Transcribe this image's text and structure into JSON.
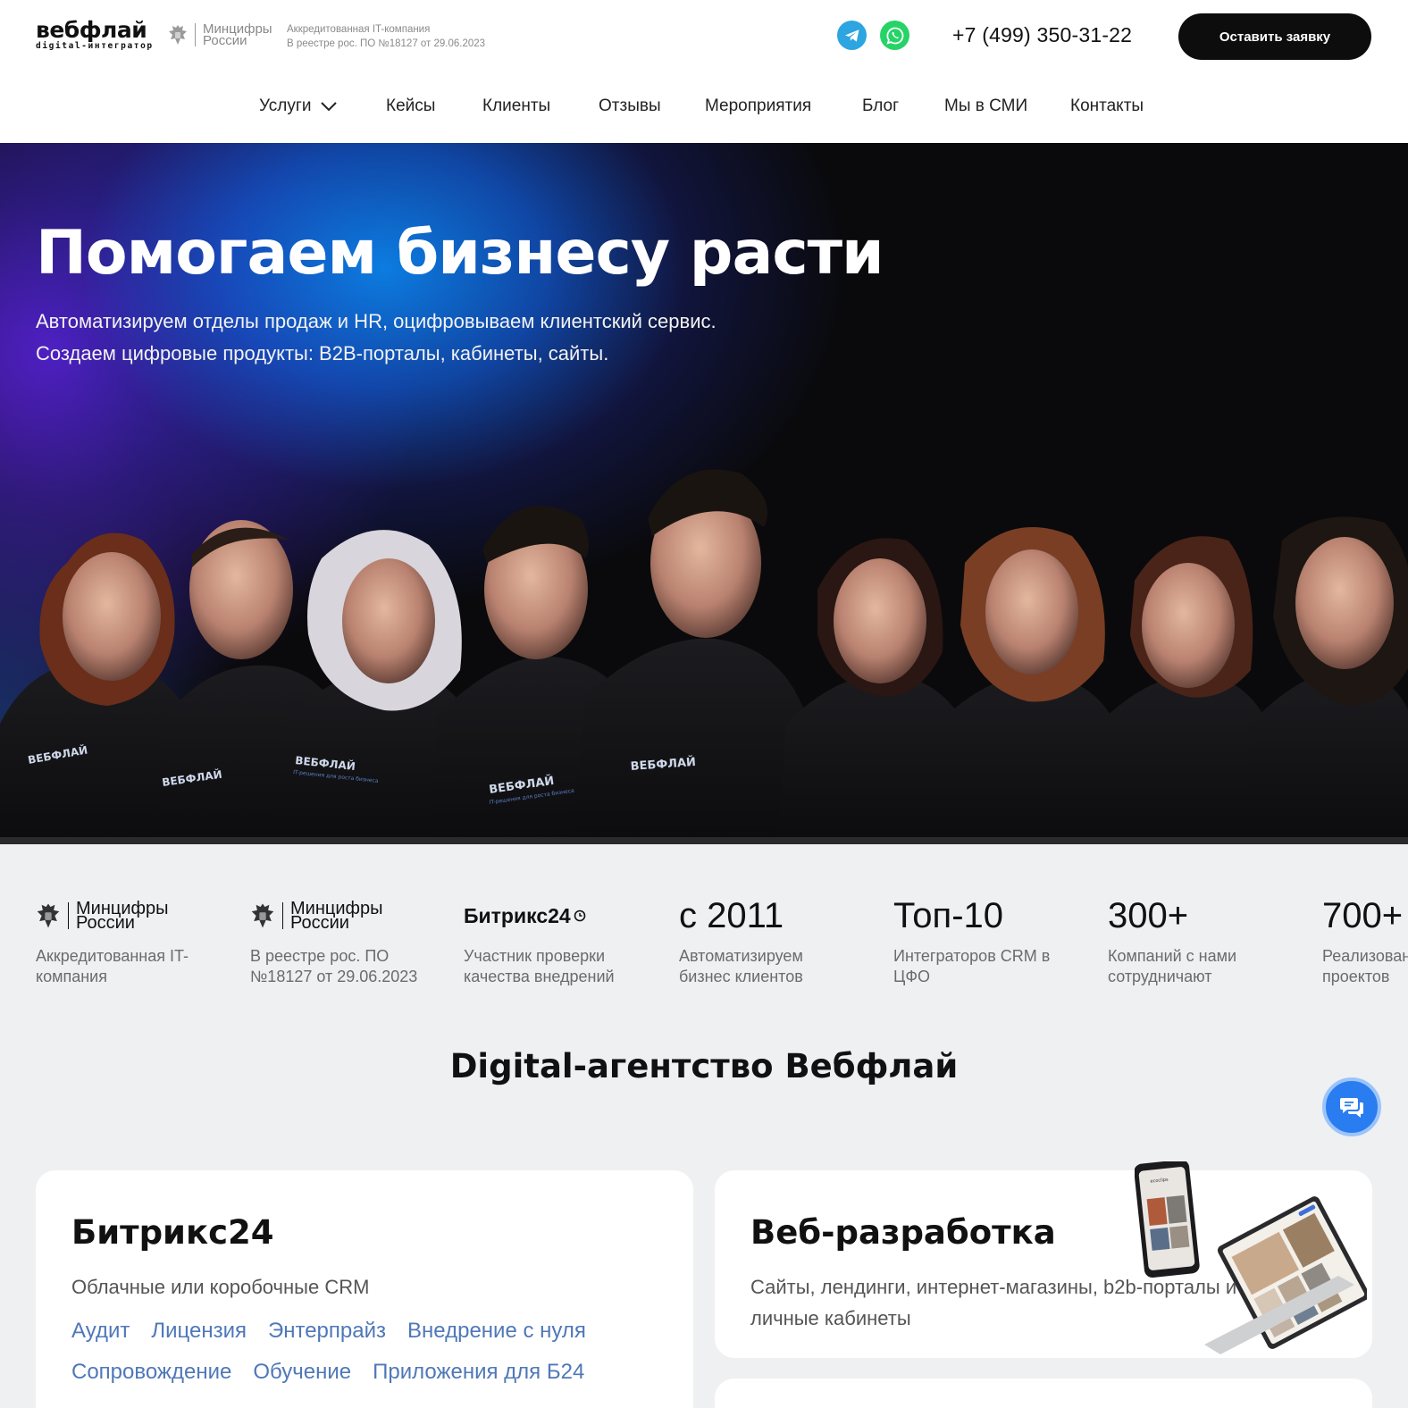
{
  "header": {
    "logo_main": "вебфлай",
    "logo_sub": "digital-интегратор",
    "mincifry_line1": "Минцифры",
    "mincifry_line2": "России",
    "accred_line1": "Аккредитованная IT-компания",
    "accred_line2": "В реестре рос. ПО №18127 от 29.06.2023",
    "phone": "+7 (499) 350-31-22",
    "cta": "Оставить заявку",
    "icons": [
      "telegram-icon",
      "whatsapp-icon",
      "chevron-down-icon"
    ]
  },
  "nav": {
    "items": [
      "Услуги",
      "Кейсы",
      "Клиенты",
      "Отзывы",
      "Мероприятия",
      "Блог",
      "Мы в СМИ",
      "Контакты"
    ]
  },
  "hero": {
    "title": "Помогаем бизнесу расти",
    "subtitle": "Автоматизируем отделы продаж и HR, оцифровываем клиентский сервис. Создаем цифровые продукты: B2B-порталы, кабинеты, сайты.",
    "hoodie_print": "ВЕБФЛАЙ",
    "hoodie_tagline": "IT-решения для роста бизнеса"
  },
  "stats": [
    {
      "line1": "Минцифры",
      "line2": "России",
      "desc": "Аккредитованная IT-компания"
    },
    {
      "line1": "Минцифры",
      "line2": "России",
      "desc": "В реестре рос. ПО №18127 от 29.06.2023"
    },
    {
      "logo": "Битрикс24",
      "desc": "Участник проверки качества внедрений"
    },
    {
      "big": "с 2011",
      "desc": "Автоматизируем бизнес клиентов"
    },
    {
      "big": "Топ-10",
      "desc": "Интеграторов CRM в ЦФО"
    },
    {
      "big": "300+",
      "desc": "Компаний с нами сотрудничают"
    },
    {
      "big": "700+",
      "desc": "Реализованных проектов"
    }
  ],
  "section": {
    "title": "Digital-агентство Вебфлай"
  },
  "cards": {
    "bitrix": {
      "title": "Битрикс24",
      "desc": "Облачные или коробочные CRM",
      "links": [
        "Аудит",
        "Лицензия",
        "Энтерпрайз",
        "Внедрение с нуля",
        "Сопровождение",
        "Обучение",
        "Приложения для Б24"
      ]
    },
    "web": {
      "title": "Веб-разработка",
      "desc": "Сайты, лендинги, интернет-магазины, b2b-порталы и личные кабинеты",
      "phone_screen_label": "ecoclips"
    }
  },
  "colors": {
    "accent_blue": "#2a7df0",
    "link_blue": "#4f78b8",
    "telegram": "#2ca5e0",
    "whatsapp": "#25d366",
    "cta_bg": "#0d0d0d"
  }
}
